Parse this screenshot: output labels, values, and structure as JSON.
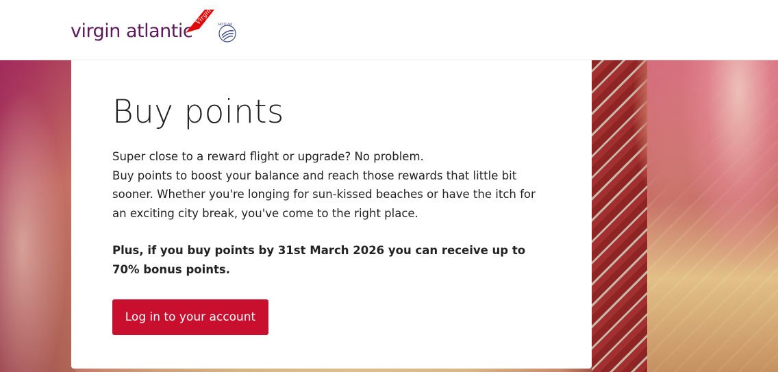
{
  "header": {
    "logo_text": "virgin atlantic",
    "logo_flag_text": "Virgin",
    "alliance_text": "SKYTEAM"
  },
  "card": {
    "title": "Buy points",
    "intro_line1": "Super close to a reward flight or upgrade? No problem.",
    "intro_line2": "Buy points to boost your balance and reach those rewards that little bit sooner. Whether you're longing for sun-kissed beaches or have the itch for an exciting city break, you've come to the right place.",
    "promo": "Plus, if you buy points by 31st March 2026 you can receive up to 70% bonus points.",
    "cta_label": "Log in to your account"
  },
  "colors": {
    "brand_purple": "#5b1a5a",
    "brand_red": "#c8102e"
  },
  "icons": {
    "logo_flag": "virgin-flag-icon",
    "alliance": "skyteam-icon"
  }
}
